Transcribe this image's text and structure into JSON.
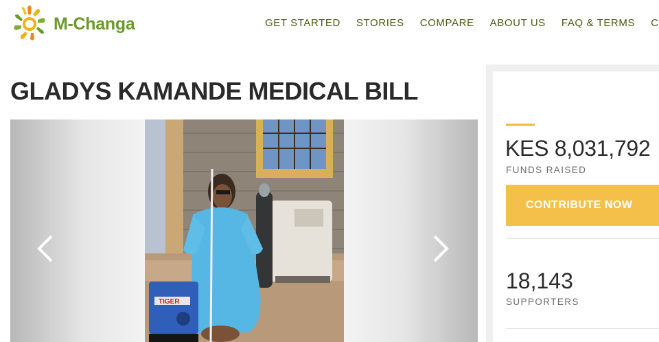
{
  "header": {
    "logo_text": "M-Changa",
    "nav": [
      "GET STARTED",
      "STORIES",
      "COMPARE",
      "ABOUT US",
      "FAQ & TERMS",
      "CO"
    ]
  },
  "campaign": {
    "title": "GLADYS KAMANDE MEDICAL BILL"
  },
  "stats": {
    "funds_amount": "KES 8,031,792",
    "funds_label": "FUNDS RAISED",
    "contribute_label": "CONTRIBUTE NOW",
    "supporters_count": "18,143",
    "supporters_label": "SUPPORTERS"
  },
  "photo": {
    "generator_label": "TIGER"
  },
  "colors": {
    "accent": "#f4c04a",
    "logo_green": "#6a9a2a",
    "nav_text": "#4a5a14"
  },
  "icons": [
    "sun-logo-icon",
    "chevron-left-icon",
    "chevron-right-icon"
  ]
}
